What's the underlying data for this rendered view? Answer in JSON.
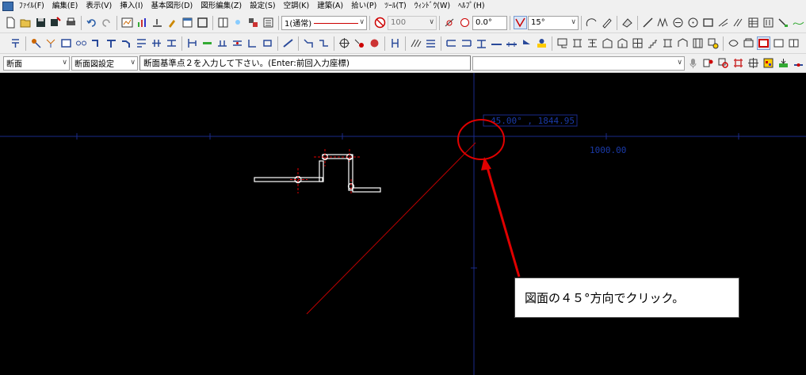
{
  "menu": {
    "items": [
      "ﾌｧｲﾙ(F)",
      "編集(E)",
      "表示(V)",
      "挿入(I)",
      "基本図形(D)",
      "図形編集(Z)",
      "設定(S)",
      "空調(K)",
      "建築(A)",
      "拾い(P)",
      "ﾂｰﾙ(T)",
      "ｳｨﾝﾄﾞｳ(W)",
      "ﾍﾙﾌﾟ(H)"
    ]
  },
  "toolbar1": {
    "layer_combo": "1(通常)",
    "percent_value": "100",
    "angle_value": "0.0°",
    "snap_angle_combo": "15°"
  },
  "toolbar3": {
    "view_combo": "断面",
    "setting_combo": "断面図設定",
    "prompt": "断面基準点２を入力して下さい。(Enter:前回入力座標)",
    "command_input": ""
  },
  "canvas": {
    "coord_readout": "45.00° , 1844.95",
    "dimension_text": "1000.00"
  },
  "callout": {
    "text": "図面の４５°方向でクリック。"
  },
  "colors": {
    "chrome": "#f0f0f0",
    "canvas": "#000000",
    "axis": "#1a2a8a",
    "rubber_band": "#c00000",
    "annotation": "#e00000",
    "pipe": "#ffffff"
  }
}
